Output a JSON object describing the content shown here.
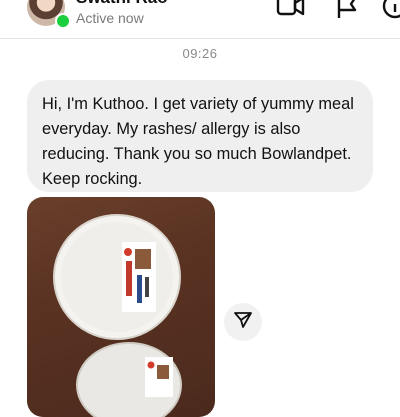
{
  "header": {
    "contact_name": "Swathi Rao",
    "status": "Active now",
    "icons": [
      "video-call-icon",
      "flag-icon",
      "info-icon"
    ]
  },
  "conversation": {
    "timestamp": "09:26",
    "message": "Hi, I'm  Kuthoo. I get variety of yummy meal everyday. My rashes/ allergy is also reducing. Thank you so much Bowlandpet. Keep rocking."
  },
  "attachment": {
    "type": "photo",
    "share_icon": "send-icon"
  },
  "colors": {
    "active": "#1ccf3e",
    "bubble": "#efefef",
    "status_text": "#7a7a7a"
  }
}
